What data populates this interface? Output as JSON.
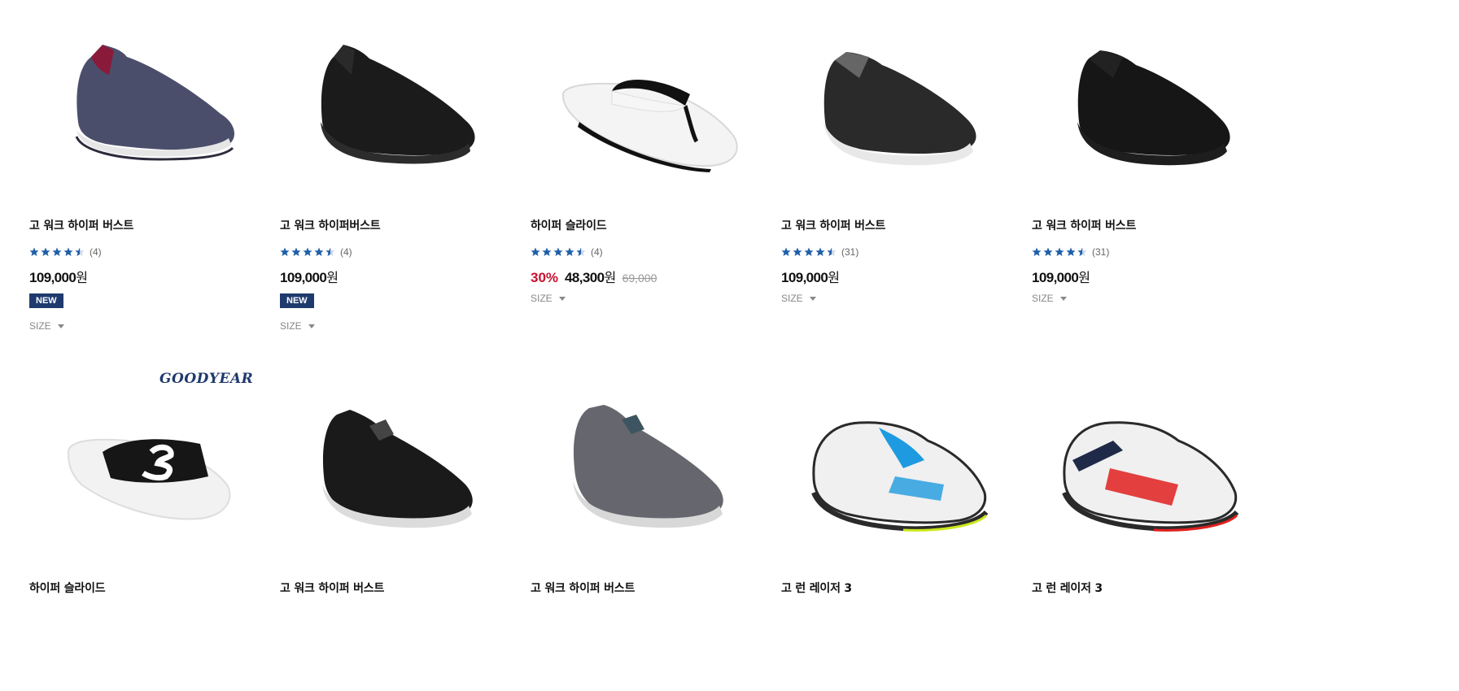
{
  "products": [
    {
      "name": "고 워크 하이퍼 버스트",
      "rating": "4.5",
      "reviews": "(4)",
      "price": "109,000",
      "currency": "원",
      "badge": "NEW",
      "size_label": "SIZE",
      "image": "slip-on-shoe-navy-icon",
      "colors": {
        "upper": "#4b4e6b",
        "accent": "#8a1a3a",
        "sole": "#e6e6e6"
      }
    },
    {
      "name": "고 워크 하이퍼버스트",
      "rating": "4.5",
      "reviews": "(4)",
      "price": "109,000",
      "currency": "원",
      "badge": "NEW",
      "size_label": "SIZE",
      "image": "slip-on-shoe-black-icon",
      "colors": {
        "upper": "#1b1b1b",
        "accent": "#2a2a2a",
        "sole": "#2c2c2c"
      }
    },
    {
      "name": "하이퍼 슬라이드",
      "rating": "4.5",
      "reviews": "(4)",
      "discount": "30%",
      "price": "48,300",
      "currency": "원",
      "original_price": "69,000",
      "size_label": "SIZE",
      "image": "flip-flop-white-icon",
      "colors": {
        "strap": "#111111",
        "sole": "#f4f4f4"
      }
    },
    {
      "name": "고 워크 하이퍼 버스트",
      "rating": "4.5",
      "reviews": "(31)",
      "price": "109,000",
      "currency": "원",
      "size_label": "SIZE",
      "image": "slip-on-shoe-black-white-sole-icon",
      "colors": {
        "upper": "#2a2a2a",
        "accent": "#666666",
        "sole": "#e8e8e8"
      }
    },
    {
      "name": "고 워크 하이퍼 버스트",
      "rating": "4.5",
      "reviews": "(31)",
      "price": "109,000",
      "currency": "원",
      "size_label": "SIZE",
      "image": "slip-on-shoe-all-black-icon",
      "colors": {
        "upper": "#161616",
        "accent": "#222222",
        "sole": "#1e1e1e"
      }
    },
    {
      "name": "하이퍼 슬라이드",
      "brand_logo": "GOODYEAR",
      "image": "slide-sandal-black-white-icon",
      "colors": {
        "strap": "#161616",
        "sole": "#f2f2f2"
      }
    },
    {
      "name": "고 워크 하이퍼 버스트",
      "image": "knit-slip-on-black-icon",
      "colors": {
        "upper": "#1a1a1a",
        "accent": "#444444",
        "sole": "#dcdcdc"
      }
    },
    {
      "name": "고 워크 하이퍼 버스트",
      "image": "knit-slip-on-grey-icon",
      "colors": {
        "upper": "#66666e",
        "accent": "#3d5560",
        "sole": "#d8d8d8"
      }
    },
    {
      "name": "고 런 레이저 3",
      "image": "running-shoe-white-blue-icon",
      "colors": {
        "upper": "#f0f0f0",
        "accent": "#1e9be0",
        "sole": "#2a2a2a"
      }
    },
    {
      "name": "고 런 레이저 3",
      "image": "running-shoe-white-red-icon",
      "colors": {
        "upper": "#f0f0f0",
        "accent": "#e02020",
        "sole": "#2a2a2a"
      }
    }
  ],
  "colors": {
    "star": "#1f5fa8",
    "badge": "#1f3a6d",
    "discount": "#c8102e"
  }
}
